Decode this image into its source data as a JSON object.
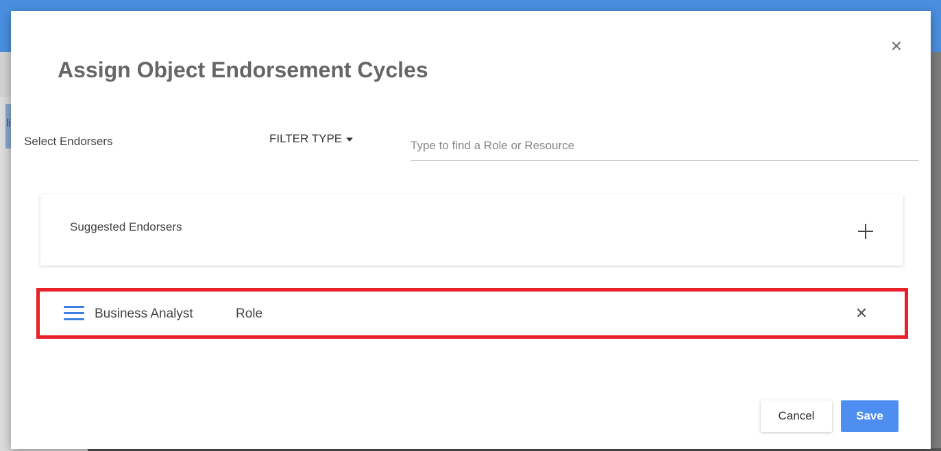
{
  "modal": {
    "title": "Assign Object Endorsement Cycles",
    "close_icon": "close-icon"
  },
  "endorser_picker": {
    "select_label": "Select Endorsers",
    "filter_type_label": "FILTER TYPE",
    "search_placeholder": "Type to find a Role or Resource",
    "search_value": ""
  },
  "suggested": {
    "label": "Suggested Endorsers",
    "add_icon": "plus-icon"
  },
  "endorsers": [
    {
      "name": "Business Analyst",
      "type": "Role",
      "drag_icon": "drag-handle-icon",
      "remove_icon": "close-icon"
    }
  ],
  "background": {
    "letter": "li"
  },
  "footer": {
    "cancel_label": "Cancel",
    "save_label": "Save"
  },
  "colors": {
    "accent": "#4d8ef0",
    "highlight_border": "#e8202a",
    "title_text": "#666666"
  }
}
